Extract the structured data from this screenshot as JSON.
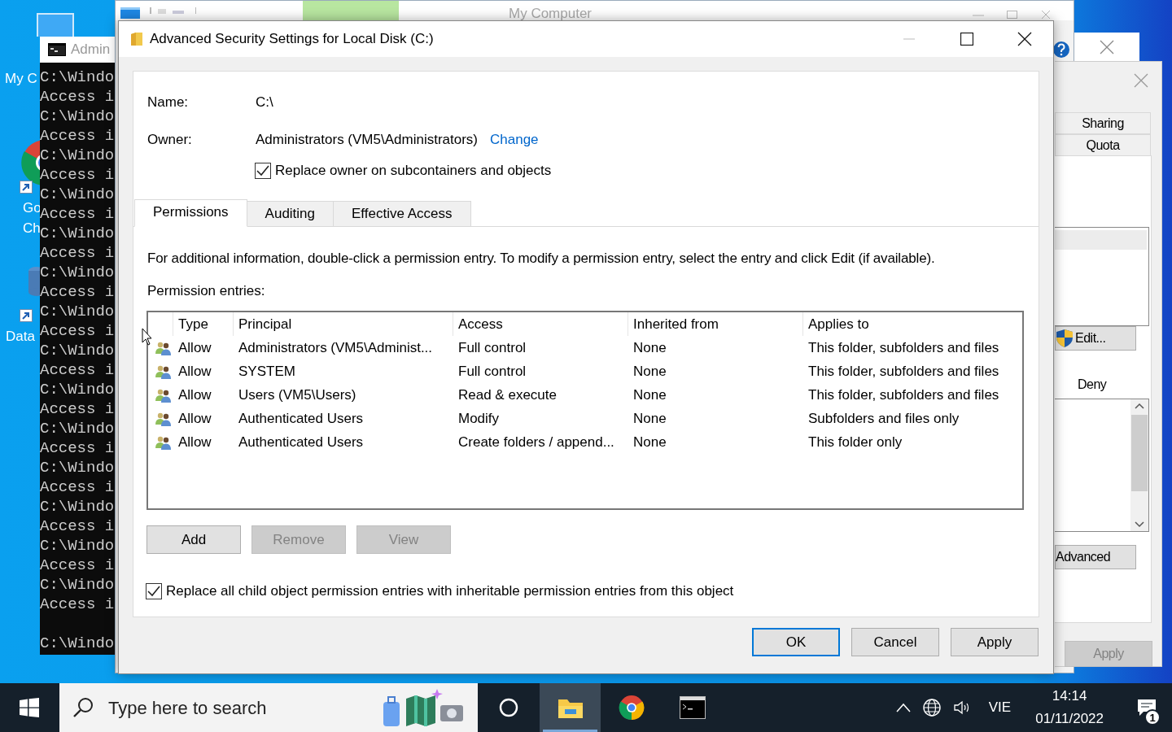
{
  "desktop_icons": [
    {
      "kind": "computer",
      "lines": [
        "My C"
      ]
    },
    {
      "kind": "browser",
      "lines": [
        "Go",
        "Ch"
      ]
    },
    {
      "kind": "database",
      "lines": [
        "Data"
      ]
    }
  ],
  "console_window": {
    "title": "Admin",
    "lines": [
      "C:\\Windo",
      "Access i",
      "C:\\Windo",
      "Access i",
      "C:\\Windo",
      "Access i",
      "C:\\Windo",
      "Access i",
      "C:\\Windo",
      "Access i",
      "C:\\Windo",
      "Access i",
      "C:\\Windo",
      "Access i",
      "C:\\Windo",
      "Access i",
      "C:\\Windo",
      "Access i",
      "C:\\Windo",
      "Access i",
      "C:\\Windo",
      "Access i",
      "C:\\Windo",
      "Access i",
      "C:\\Windo",
      "Access i",
      "C:\\Windo",
      "Access i"
    ],
    "prompt": "C:\\Windo"
  },
  "explorer_window": {
    "title": "My Computer"
  },
  "properties_dialog": {
    "tabs": [
      {
        "label": "Sharing"
      },
      {
        "label": "Quota"
      }
    ],
    "edit_button": "Edit...",
    "deny_label": "Deny",
    "advanced_button": "Advanced",
    "apply_button": {
      "label": "Apply",
      "disabled": true
    }
  },
  "dialog": {
    "title": "Advanced Security Settings for Local Disk (C:)",
    "name_label": "Name:",
    "name": "C:\\",
    "owner_label": "Owner:",
    "owner": "Administrators (VM5\\Administrators)",
    "change_link": "Change",
    "replace_owner": {
      "label": "Replace owner on subcontainers and objects",
      "checked": true
    },
    "tabs": [
      {
        "label": "Permissions",
        "selected": true
      },
      {
        "label": "Auditing",
        "selected": false
      },
      {
        "label": "Effective Access",
        "selected": false
      }
    ],
    "info": "For additional information, double-click a permission entry. To modify a permission entry, select the entry and click Edit (if available).",
    "entries_label": "Permission entries:",
    "table": {
      "columns": [
        "Type",
        "Principal",
        "Access",
        "Inherited from",
        "Applies to"
      ],
      "rows": [
        {
          "type": "Allow",
          "principal": "Administrators (VM5\\Administ...",
          "access": "Full control",
          "inherited_from": "None",
          "applies_to": "This folder, subfolders and files"
        },
        {
          "type": "Allow",
          "principal": "SYSTEM",
          "access": "Full control",
          "inherited_from": "None",
          "applies_to": "This folder, subfolders and files"
        },
        {
          "type": "Allow",
          "principal": "Users (VM5\\Users)",
          "access": "Read & execute",
          "inherited_from": "None",
          "applies_to": "This folder, subfolders and files"
        },
        {
          "type": "Allow",
          "principal": "Authenticated Users",
          "access": "Modify",
          "inherited_from": "None",
          "applies_to": "Subfolders and files only"
        },
        {
          "type": "Allow",
          "principal": "Authenticated Users",
          "access": "Create folders / append...",
          "inherited_from": "None",
          "applies_to": "This folder only"
        }
      ]
    },
    "buttons": [
      {
        "label": "Add",
        "disabled": false
      },
      {
        "label": "Remove",
        "disabled": true
      },
      {
        "label": "View",
        "disabled": true
      }
    ],
    "replace_child": {
      "label": "Replace all child object permission entries with inheritable permission entries from this object",
      "checked": true
    },
    "footer_buttons": [
      {
        "label": "OK",
        "default": true
      },
      {
        "label": "Cancel",
        "default": false
      },
      {
        "label": "Apply",
        "default": false
      }
    ]
  },
  "taskbar": {
    "search_placeholder": "Type here to search",
    "apps": [
      {
        "kind": "folder",
        "selected": true
      },
      {
        "kind": "browser",
        "selected": false
      },
      {
        "kind": "console",
        "selected": false
      }
    ],
    "language": "VIE",
    "time": "14:14",
    "date": "01/11/2022",
    "notification_count": "1"
  }
}
